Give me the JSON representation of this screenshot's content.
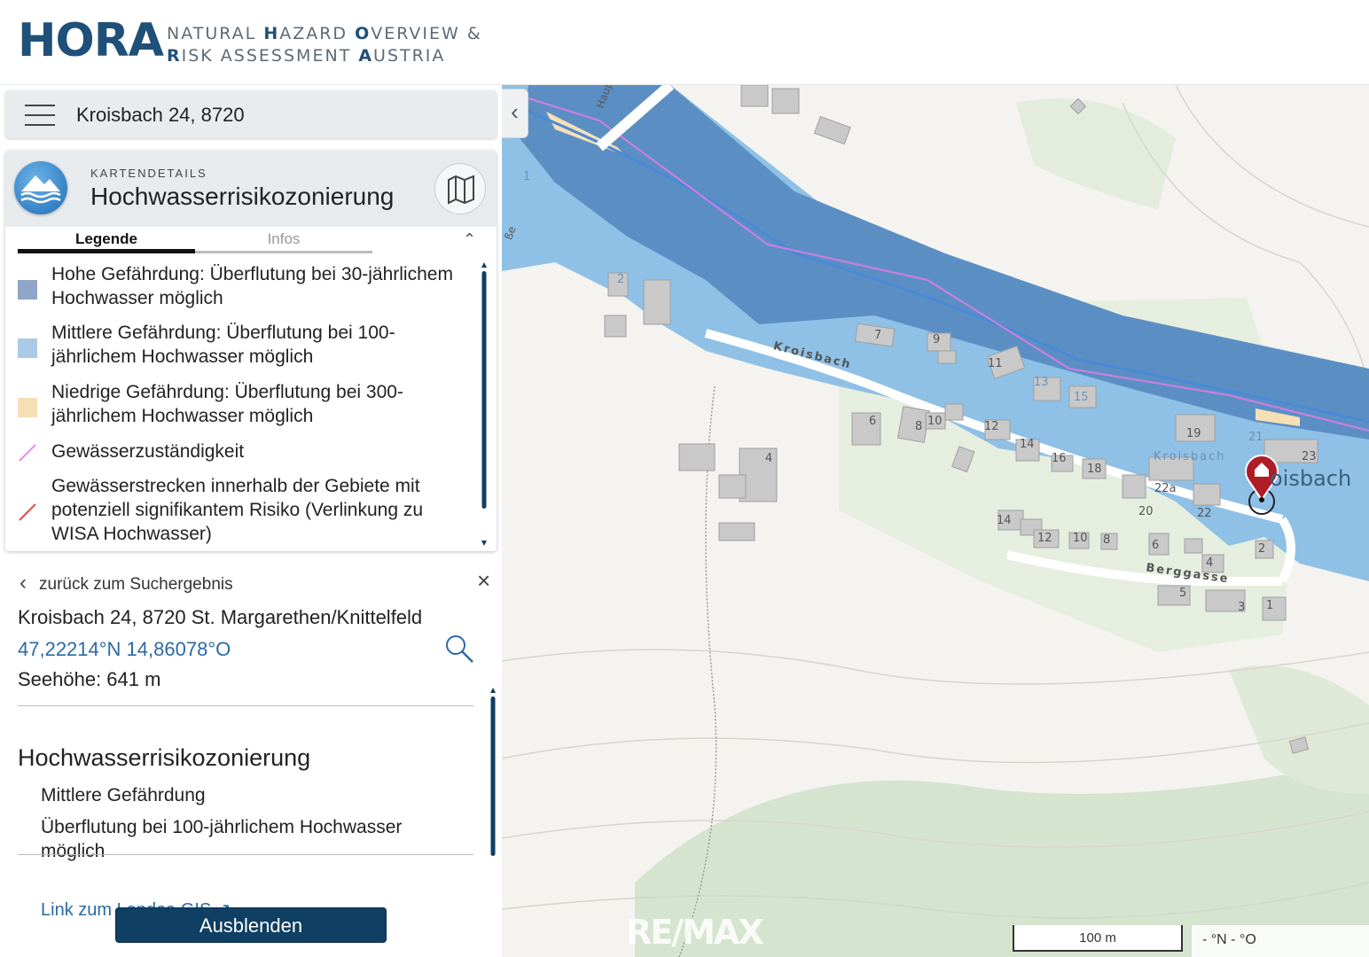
{
  "header": {
    "logo": "HORA",
    "subtitle_line1_parts": [
      "NATURAL ",
      "H",
      "AZARD ",
      "O",
      "VERVIEW &"
    ],
    "subtitle_line2_parts": [
      "R",
      "ISK ASSESSMENT ",
      "A",
      "USTRIA"
    ]
  },
  "search": {
    "value": "Kroisbach 24, 8720"
  },
  "details": {
    "kicker": "KARTENDETAILS",
    "title": "Hochwasserrisikozonierung",
    "tabs": [
      "Legende",
      "Infos"
    ],
    "legend": [
      {
        "label": "Hohe Gefährdung: Überflutung bei 30-jährlichem Hochwasser möglich",
        "color": "#8fa6c9",
        "icon": "square-swatch"
      },
      {
        "label": "Mittlere Gefährdung: Überflutung bei 100-jährlichem Hochwasser möglich",
        "color": "#a9cbe6",
        "icon": "square-swatch"
      },
      {
        "label": "Niedrige Gefährdung: Überflutung bei 300-jährlichem Hochwasser möglich",
        "color": "#f7dfb5",
        "icon": "square-swatch"
      },
      {
        "label": "Gewässerzuständigkeit",
        "color": "#e78ce6",
        "icon": "line-swatch"
      },
      {
        "label": "Gewässerstrecken innerhalb der Gebiete mit potenziell signifikantem Risiko (Verlinkung zu WISA Hochwasser)",
        "color": "#e34b4b",
        "icon": "line-swatch"
      }
    ]
  },
  "result": {
    "back_label": "zurück zum Suchergebnis",
    "address": "Kroisbach 24, 8720 St. Margarethen/Knittelfeld",
    "coordinates": "47,22214°N 14,86078°O",
    "elevation": "Seehöhe: 641 m",
    "section_title": "Hochwasserrisikozonierung",
    "hazard_level": "Mittlere Gefährdung",
    "hazard_description": "Überflutung bei 100-jährlichem Hochwasser möglich",
    "link_label": "Link zum Landes-GIS"
  },
  "hide_button": "Ausblenden",
  "map": {
    "street_labels": [
      "Kroisbach",
      "Kroisbach",
      "Berggasse",
      "Haup",
      "ße"
    ],
    "place_label": "oisbach",
    "house_numbers": [
      "7",
      "9",
      "11",
      "13",
      "15",
      "2",
      "1",
      "6",
      "8",
      "10",
      "12",
      "14",
      "16",
      "18",
      "19",
      "21",
      "23",
      "4",
      "22a",
      "20",
      "22",
      "14",
      "12",
      "10",
      "8",
      "6",
      "4",
      "2",
      "5",
      "3",
      "1"
    ],
    "scale": "100 m",
    "coords_readout": "- °N - °O",
    "watermark": "RE/MAX",
    "colors": {
      "flood_high": "#5b8fc4",
      "flood_medium": "#8fc0e6",
      "flood_low": "#f7dfb5",
      "river": "#4a89d6",
      "responsibility_line": "#d27de0",
      "marker": "#b01c26"
    }
  }
}
